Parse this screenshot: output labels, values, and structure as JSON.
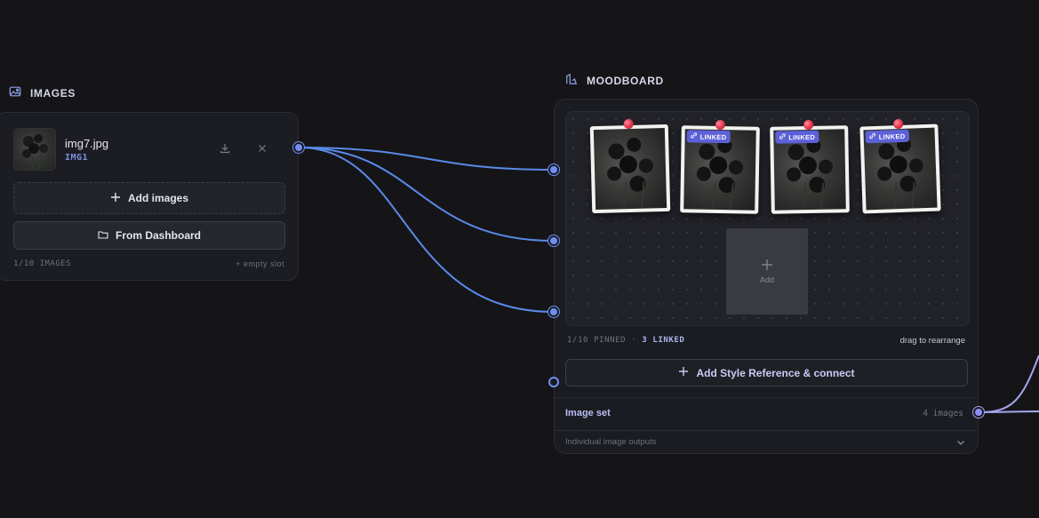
{
  "images_node": {
    "title": "IMAGES",
    "file": {
      "name": "img7.jpg",
      "id": "IMG1"
    },
    "add_images_label": "Add images",
    "from_dashboard_label": "From Dashboard",
    "count_label": "1/10 IMAGES",
    "empty_slot_label": "+ empty slot"
  },
  "moodboard_node": {
    "title": "MOODBOARD",
    "photos": [
      {
        "linked": false,
        "badge": ""
      },
      {
        "linked": true,
        "badge": "LINKED"
      },
      {
        "linked": true,
        "badge": "LINKED"
      },
      {
        "linked": true,
        "badge": "LINKED"
      }
    ],
    "add_slot_label": "Add",
    "pinned_label": "1/10 PINNED",
    "separator": "·",
    "linked_label": "3 LINKED",
    "rearrange_hint": "drag to rearrange",
    "add_reference_label": "Add Style Reference & connect",
    "output_label": "Image set",
    "output_count": "4 images",
    "sub_output_label": "Individual image outputs"
  },
  "colors": {
    "background": "#151518",
    "wire": "#5a8ae8",
    "accent": "#6f8ff2",
    "linked_badge": "#5d61d8",
    "pin": "#e03048"
  }
}
